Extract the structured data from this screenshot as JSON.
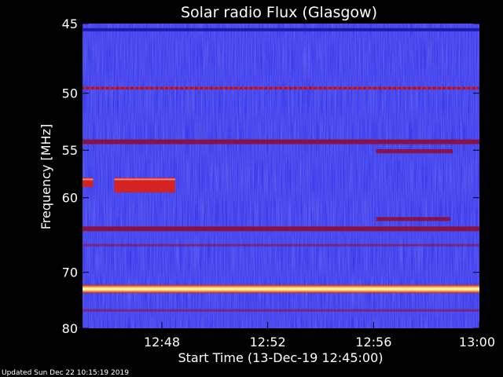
{
  "chart_data": {
    "type": "heatmap",
    "title": "Solar radio Flux (Glasgow)",
    "xlabel": "Start Time (13-Dec-19 12:45:00)",
    "ylabel": "Frequency [MHz]",
    "footer": "Updated Sun Dec 22 10:15:19 2019",
    "x_range_minutes": [
      0,
      15
    ],
    "x_ticks": [
      {
        "minute": 3,
        "label": "12:48"
      },
      {
        "minute": 7,
        "label": "12:52"
      },
      {
        "minute": 11,
        "label": "12:56"
      },
      {
        "minute": 15,
        "label": "13:00"
      }
    ],
    "y_range_mhz": [
      45,
      80
    ],
    "y_scale": "reciprocal",
    "y_ticks": [
      {
        "value": 45,
        "label": "45"
      },
      {
        "value": 50,
        "label": "50"
      },
      {
        "value": 55,
        "label": "55"
      },
      {
        "value": 60,
        "label": "60"
      },
      {
        "value": 70,
        "label": "70"
      },
      {
        "value": 80,
        "label": "80"
      }
    ],
    "colors": {
      "background_low": "#2a2ae8",
      "medium": "#8a1040",
      "high": "#e02010",
      "peak": "#ffffff"
    },
    "bands": [
      {
        "freq_mhz": 45.4,
        "level": "low-dark",
        "t_start": 0,
        "t_end": 15
      },
      {
        "freq_mhz": 49.6,
        "level": "high-dotted",
        "t_start": 0,
        "t_end": 15
      },
      {
        "freq_mhz": 54.2,
        "level": "medium",
        "t_start": 0,
        "t_end": 15
      },
      {
        "freq_mhz": 63.8,
        "level": "medium",
        "t_start": 0,
        "t_end": 15
      },
      {
        "freq_mhz": 66.0,
        "level": "medium-faint",
        "t_start": 0,
        "t_end": 15
      },
      {
        "freq_mhz": 72.7,
        "level": "peak",
        "t_start": 0,
        "t_end": 15
      },
      {
        "freq_mhz": 76.5,
        "level": "medium-faint",
        "t_start": 0,
        "t_end": 15
      }
    ],
    "bursts": [
      {
        "t_start": 0.0,
        "t_end": 0.4,
        "f_start": 57.8,
        "f_end": 58.8,
        "level": "high"
      },
      {
        "t_start": 1.2,
        "t_end": 3.5,
        "f_start": 57.8,
        "f_end": 59.4,
        "level": "high"
      },
      {
        "t_start": 11.1,
        "t_end": 14.0,
        "f_start": 54.9,
        "f_end": 55.3,
        "level": "medium"
      },
      {
        "t_start": 11.1,
        "t_end": 13.9,
        "f_start": 62.3,
        "f_end": 62.8,
        "level": "medium"
      }
    ]
  }
}
